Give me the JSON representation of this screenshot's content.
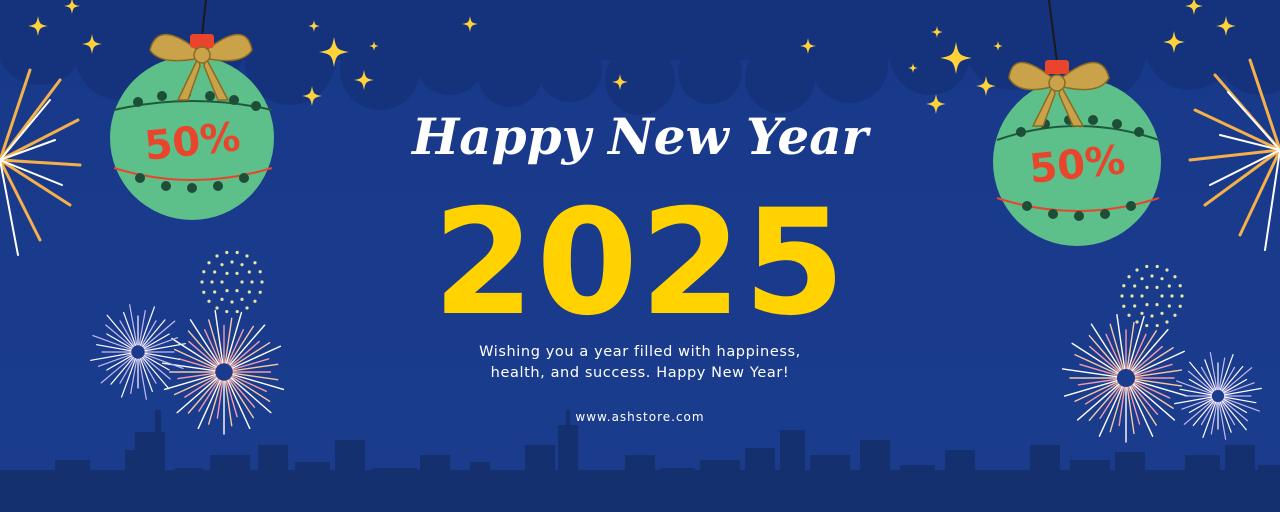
{
  "banner": {
    "headline": "Happy New Year",
    "year": "2025",
    "message_line1": "Wishing you a year filled with happiness,",
    "message_line2": "health, and success. Happy New Year!",
    "website": "www.ashstore.com"
  },
  "ornaments": [
    {
      "label": "50%"
    },
    {
      "label": "50%"
    }
  ],
  "colors": {
    "background": "#1a3b8c",
    "year": "#ffd200",
    "ornament": "#5dbf8a",
    "discount": "#e8452c",
    "bow": "#c9a24a",
    "skyline": "#132a6b",
    "stars": "#ffd23a"
  },
  "decorations": {
    "stars": "star-icon",
    "fireworks": "firework-icon",
    "skyline": "city-skyline",
    "clouds": "cloud-shape"
  }
}
